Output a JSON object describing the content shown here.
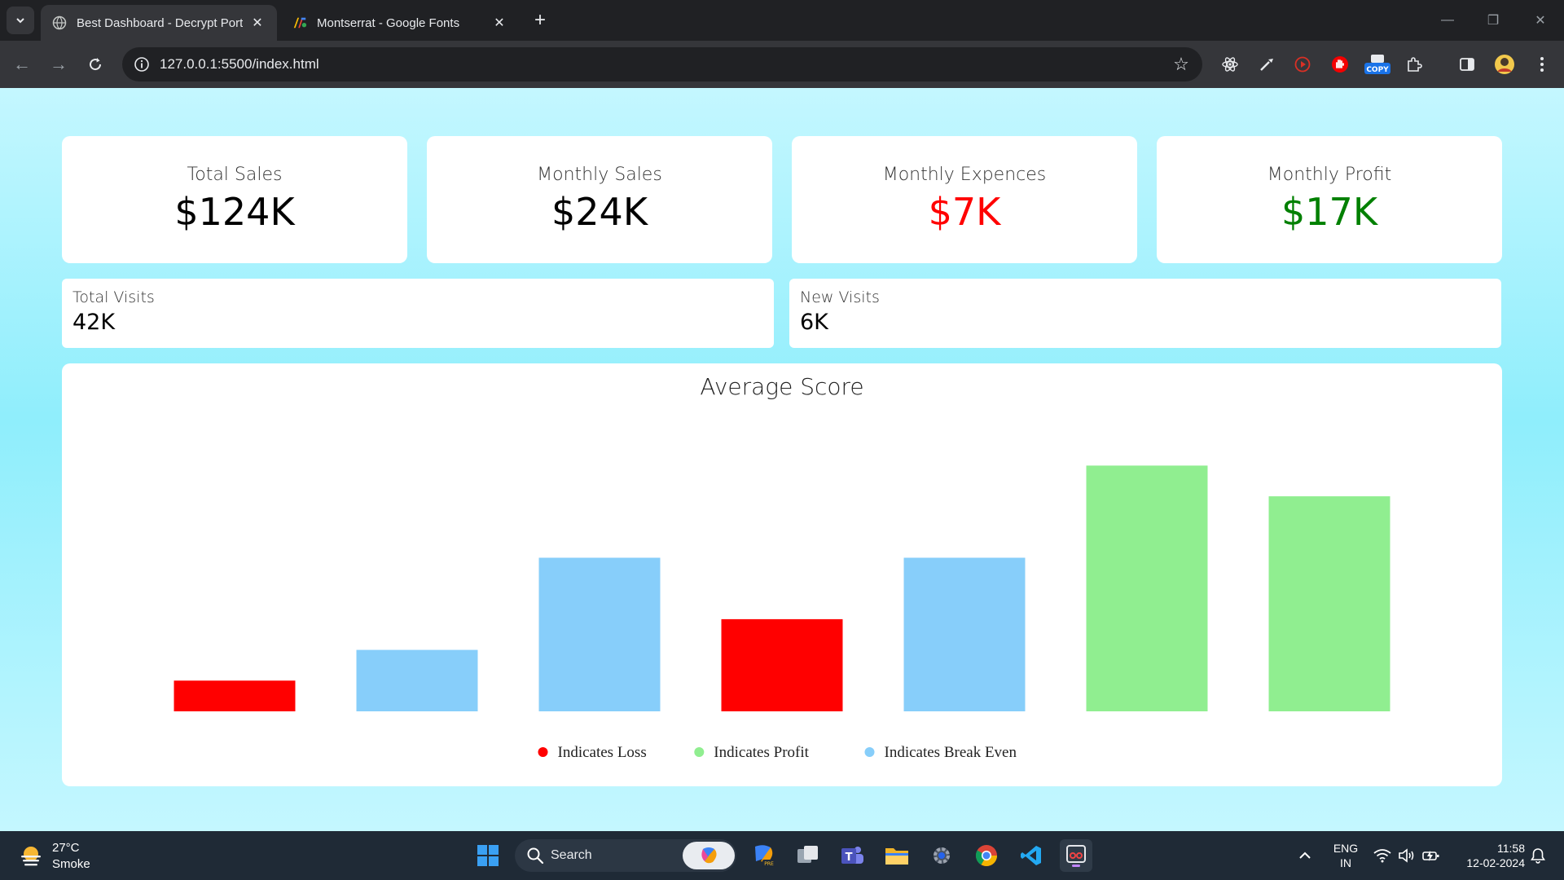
{
  "browser": {
    "tabs": [
      {
        "title": "Best Dashboard - Decrypt Porta",
        "active": true
      },
      {
        "title": "Montserrat - Google Fonts",
        "active": false
      }
    ],
    "url": "127.0.0.1:5500/index.html",
    "extensions": {
      "copy_badge": "COPY"
    }
  },
  "dashboard": {
    "stats": [
      {
        "label": "Total Sales",
        "value": "$124K",
        "color": "#000000"
      },
      {
        "label": "Monthly Sales",
        "value": "$24K",
        "color": "#000000"
      },
      {
        "label": "Monthly Expences",
        "value": "$7K",
        "color": "#ff0000"
      },
      {
        "label": "Monthly Profit",
        "value": "$17K",
        "color": "#008000"
      }
    ],
    "visits": [
      {
        "label": "Total Visits",
        "value": "42K"
      },
      {
        "label": "New Visits",
        "value": "6K"
      }
    ]
  },
  "chart_data": {
    "type": "bar",
    "title": "Average Score",
    "values": [
      10,
      20,
      50,
      30,
      50,
      80,
      70
    ],
    "colors": [
      "#ff0000",
      "#87cefa",
      "#87cefa",
      "#ff0000",
      "#87cefa",
      "#90ee90",
      "#90ee90"
    ],
    "ylim": [
      0,
      100
    ],
    "grid": false,
    "legend_position": "bottom",
    "legend": [
      {
        "label": "Indicates Loss",
        "color": "#ff0000"
      },
      {
        "label": "Indicates Profit",
        "color": "#90ee90"
      },
      {
        "label": "Indicates Break Even",
        "color": "#87cefa"
      }
    ]
  },
  "taskbar": {
    "weather": {
      "temp": "27°C",
      "desc": "Smoke"
    },
    "search_label": "Search",
    "language": {
      "line1": "ENG",
      "line2": "IN"
    },
    "clock": {
      "time": "11:58",
      "date": "12-02-2024"
    }
  }
}
